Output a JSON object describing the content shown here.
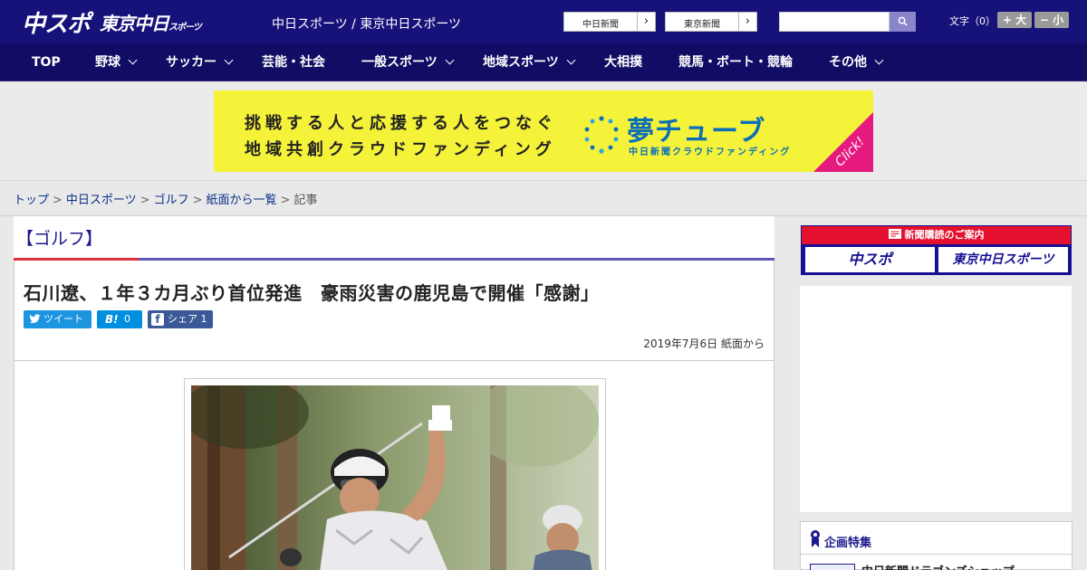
{
  "header": {
    "logo_chuspo": "中スポ",
    "logo_tokyo": "東京中日",
    "logo_tokyo_suffix": "スポーツ",
    "site_names": "中日スポーツ / 東京中日スポーツ",
    "paper_links": [
      "中日新聞",
      "東京新聞"
    ],
    "font_size_label": "文字（0）",
    "font_bigger": "+ 大",
    "font_smaller": "− 小",
    "search_placeholder": ""
  },
  "nav": {
    "items": [
      {
        "label": "TOP"
      },
      {
        "label": "野球"
      },
      {
        "label": "サッカー"
      },
      {
        "label": "芸能・社会"
      },
      {
        "label": "一般スポーツ"
      },
      {
        "label": "地域スポーツ"
      },
      {
        "label": "大相撲"
      },
      {
        "label": "競馬・ボート・競輪"
      },
      {
        "label": "その他"
      }
    ]
  },
  "banner": {
    "line1": "挑戦する人と応援する人をつなぐ",
    "line2": "地域共創クラウドファンディング",
    "brand": "夢チューブ",
    "brand_sub": "中日新聞クラウドファンディング",
    "click": "Click!"
  },
  "breadcrumb": {
    "items": [
      "トップ",
      "中日スポーツ",
      "ゴルフ",
      "紙面から一覧"
    ],
    "current": "記事",
    "separator": ">"
  },
  "article": {
    "category": "【ゴルフ】",
    "headline": "石川遼、１年３カ月ぶり首位発進　豪雨災害の鹿児島で開催「感謝」",
    "share": {
      "tweet_label": "ツイート",
      "hatena_icon": "B!",
      "hatena_count": "0",
      "fb_icon": "f",
      "fb_label": "シェア",
      "fb_count": "1"
    },
    "dateline": "2019年7月6日 紙面から"
  },
  "sidebar": {
    "subscribe_title": "新聞購読のご案内",
    "subscribe_buttons": [
      "中スポ",
      "東京中日スポーツ"
    ],
    "feature_title": "企画特集",
    "feature_item": "中日新聞ドラゴンズショップ"
  }
}
